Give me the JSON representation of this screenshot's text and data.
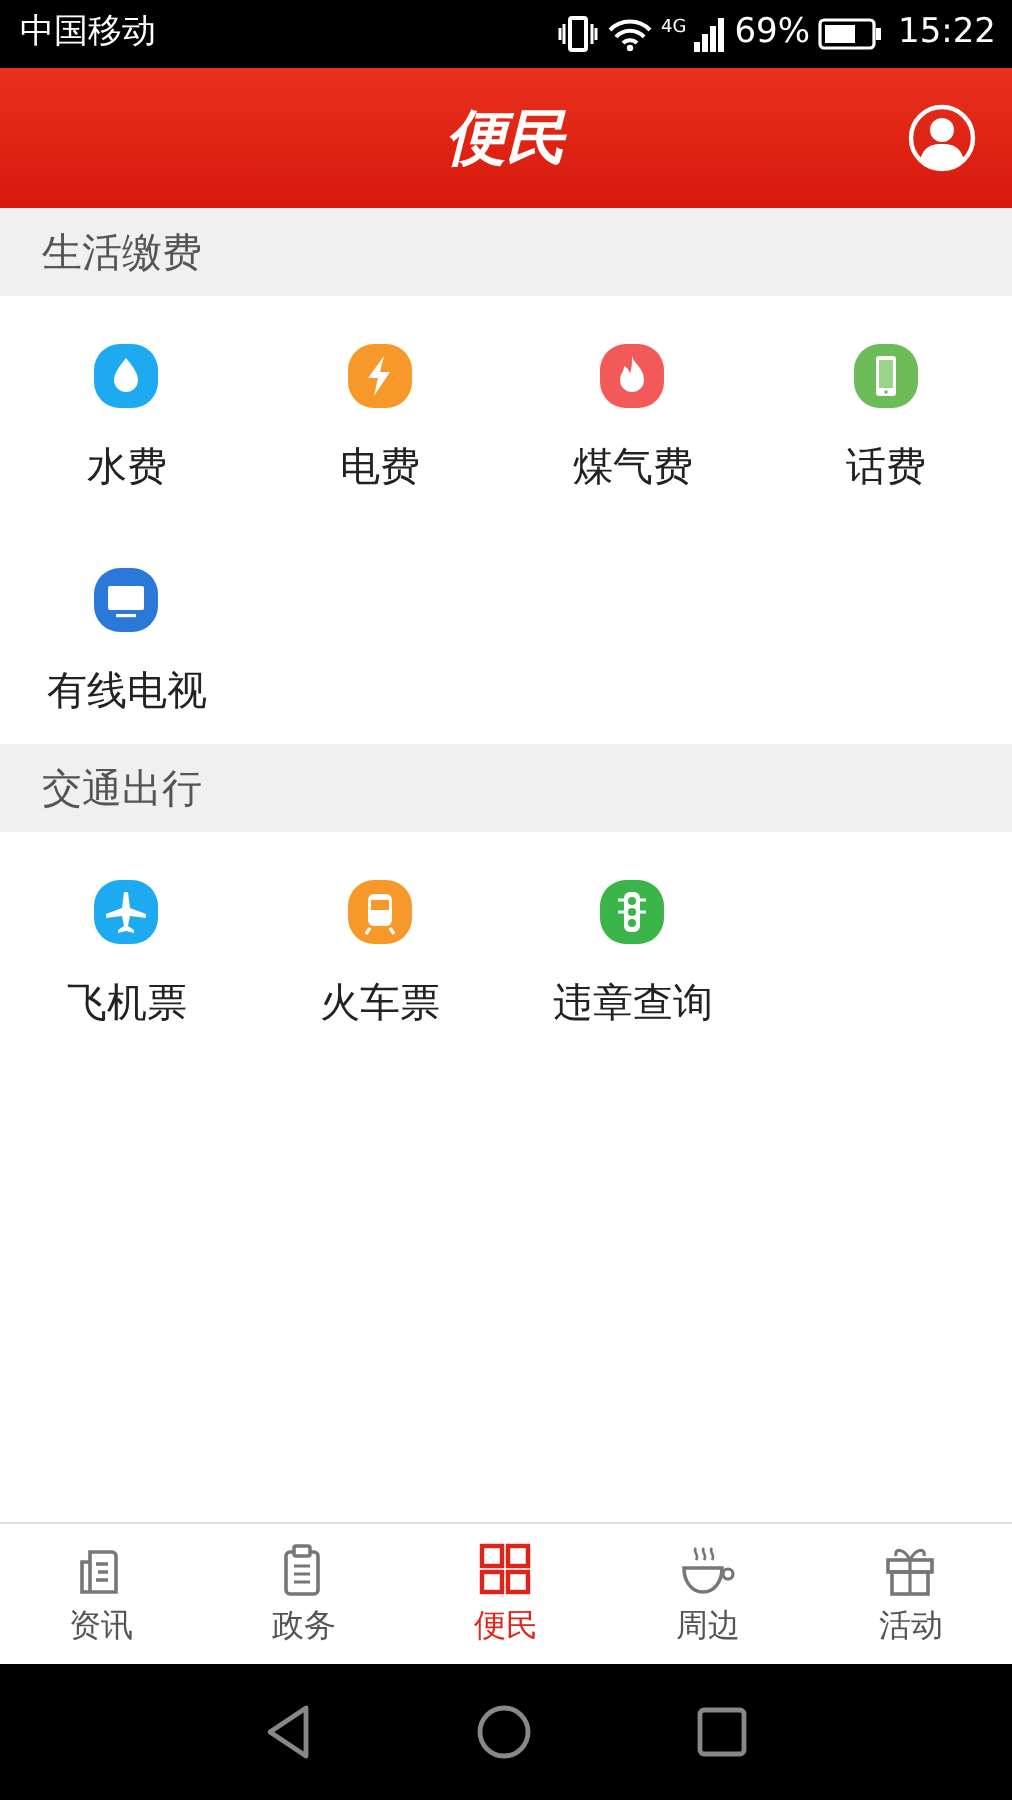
{
  "status_bar": {
    "carrier": "中国移动",
    "network": "4G",
    "battery": "69%",
    "time": "15:22"
  },
  "header": {
    "title": "便民"
  },
  "sections": [
    {
      "title": "生活缴费",
      "items": [
        {
          "label": "水费",
          "color": "#1eaaf1"
        },
        {
          "label": "电费",
          "color": "#f7982a"
        },
        {
          "label": "煤气费",
          "color": "#f25a5a"
        },
        {
          "label": "话费",
          "color": "#6cbd5a"
        },
        {
          "label": "有线电视",
          "color": "#2b78d8"
        }
      ]
    },
    {
      "title": "交通出行",
      "items": [
        {
          "label": "飞机票",
          "color": "#1eaaf1"
        },
        {
          "label": "火车票",
          "color": "#f7982a"
        },
        {
          "label": "违章查询",
          "color": "#3bb54a"
        }
      ]
    }
  ],
  "tabs": [
    {
      "label": "资讯",
      "selected": false
    },
    {
      "label": "政务",
      "selected": false
    },
    {
      "label": "便民",
      "selected": true
    },
    {
      "label": "周边",
      "selected": false
    },
    {
      "label": "活动",
      "selected": false
    }
  ]
}
